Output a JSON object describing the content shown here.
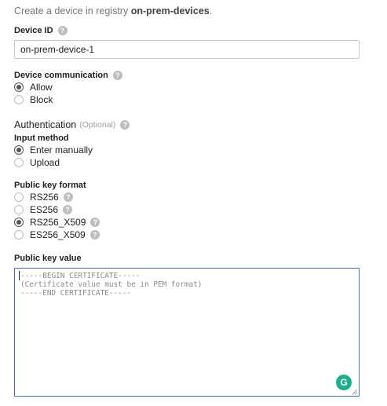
{
  "intro": {
    "prefix": "Create a device in registry ",
    "registry": "on-prem-devices",
    "suffix": "."
  },
  "device_id": {
    "label": "Device ID",
    "value": "on-prem-device-1"
  },
  "device_communication": {
    "label": "Device communication",
    "options": [
      "Allow",
      "Block"
    ],
    "selected": "Allow"
  },
  "authentication": {
    "title": "Authentication",
    "optional_note": "(Optional)"
  },
  "input_method": {
    "label": "Input method",
    "options": [
      "Enter manually",
      "Upload"
    ],
    "selected": "Enter manually"
  },
  "public_key_format": {
    "label": "Public key format",
    "options": [
      "RS256",
      "ES256",
      "RS256_X509",
      "ES256_X509"
    ],
    "selected": "RS256_X509"
  },
  "public_key_value": {
    "label": "Public key value",
    "placeholder_lines": [
      "-----BEGIN CERTIFICATE-----",
      "(Certificate value must be in PEM format)",
      "-----END CERTIFICATE-----"
    ]
  },
  "icons": {
    "help": "help-icon",
    "grammarly": "grammarly-icon",
    "resize": "resize-handle-icon"
  },
  "colors": {
    "focus_border": "#3f6fbf",
    "grammarly": "#16b08b",
    "help_icon": "#bdbdbd"
  }
}
